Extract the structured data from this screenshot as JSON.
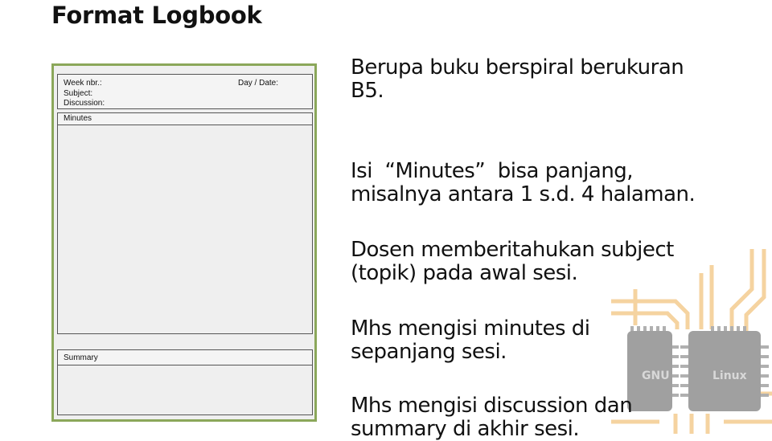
{
  "title": "Format Logbook",
  "logbook": {
    "week_label": "Week nbr.:",
    "day_date_label": "Day / Date:",
    "subject_label": "Subject:",
    "discussion_label": "Discussion:",
    "minutes_label": "Minutes",
    "summary_label": "Summary"
  },
  "points": [
    "Berupa buku berspiral berukuran\nB5.",
    "Isi  “Minutes”  bisa panjang,\nmisalnya antara 1 s.d. 4 halaman.",
    "Dosen memberitahukan subject\n(topik) pada awal sesi.",
    "Mhs mengisi minutes di\nsepanjang sesi.",
    "Mhs mengisi discussion dan\nsummary di akhir sesi."
  ],
  "deco": {
    "chip_left_label": "GNU",
    "chip_right_label": "Linux",
    "trace_color": "#f3c98a",
    "chip_color": "#9a9a9a"
  }
}
